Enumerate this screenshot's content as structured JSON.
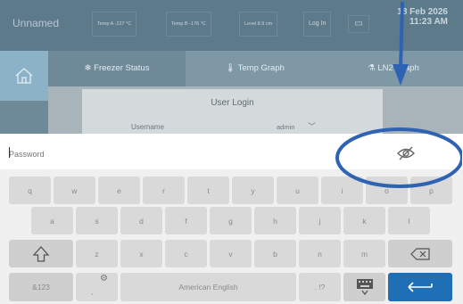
{
  "status_bar": {
    "project_name": "Unnamed",
    "temp_a": "Temp A  -227 °C",
    "temp_b": "Temp B  -176 °C",
    "level": "Level  8.9 cm",
    "login": "Log In",
    "screen_icon": "screen-icon",
    "date": "18 Feb 2026",
    "time": "11:23 AM"
  },
  "tabs": [
    {
      "label": "Freezer Status",
      "icon": "snowflake-icon"
    },
    {
      "label": "Temp Graph",
      "icon": "thermometer-icon"
    },
    {
      "label": "LN2 Graph",
      "icon": "flask-icon"
    }
  ],
  "login": {
    "title": "User Login",
    "username_label": "Username",
    "username_value": "admin"
  },
  "password": {
    "placeholder": "Password",
    "toggle_icon": "eye-slash-icon"
  },
  "keyboard": {
    "row1": [
      "q",
      "w",
      "e",
      "r",
      "t",
      "y",
      "u",
      "i",
      "o",
      "p"
    ],
    "row2": [
      "a",
      "s",
      "d",
      "f",
      "g",
      "h",
      "j",
      "k",
      "l"
    ],
    "row3": [
      "z",
      "x",
      "c",
      "v",
      "b",
      "n",
      "m"
    ],
    "symbols_label": "&123",
    "comma": ",",
    "space_label": "American English",
    "punct": ". !?",
    "enter_color": "#1f6fb6"
  },
  "annotation": {
    "color": "#2e63b4"
  }
}
